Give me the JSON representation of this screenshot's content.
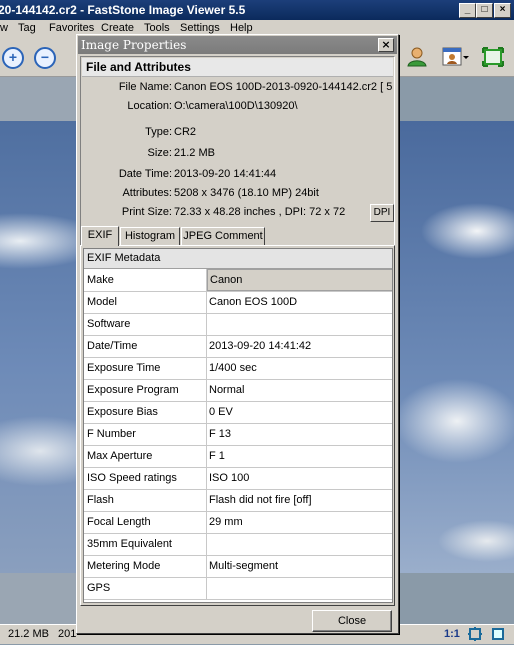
{
  "app": {
    "title": "20-144142.cr2  -  FastStone Image Viewer 5.5",
    "window_buttons": {
      "minimize": "_",
      "maximize": "□",
      "close": "×"
    },
    "menu": [
      "w",
      "Tag",
      "Favorites",
      "Create",
      "Tools",
      "Settings",
      "Help"
    ],
    "status": {
      "size": "21.2 MB",
      "partial": "201",
      "zoom": "1:1"
    }
  },
  "dialog": {
    "title": "Image Properties",
    "close_glyph": "×",
    "file_attributes": {
      "header": "File and Attributes",
      "rows": [
        {
          "label": "File Name:",
          "value": "Canon EOS 100D-2013-0920-144142.cr2   [ 5"
        },
        {
          "label": "Location:",
          "value": "O:\\camera\\100D\\130920\\"
        },
        {
          "label": "Type:",
          "value": "CR2"
        },
        {
          "label": "Size:",
          "value": "21.2 MB"
        },
        {
          "label": "Date Time:",
          "value": "2013-09-20 14:41:44"
        },
        {
          "label": "Attributes:",
          "value": "5208 x 3476 (18.10 MP)  24bit"
        },
        {
          "label": "Print Size:",
          "value": "72.33 x 48.28 inches ,   DPI: 72 x 72"
        }
      ],
      "dpi_button": "DPI"
    },
    "tabs": [
      "EXIF",
      "Histogram",
      "JPEG Comment"
    ],
    "exif": {
      "title": "EXIF Metadata",
      "rows": [
        {
          "key": "Make",
          "value": "Canon"
        },
        {
          "key": "Model",
          "value": "Canon EOS 100D"
        },
        {
          "key": "Software",
          "value": ""
        },
        {
          "key": "Date/Time",
          "value": "2013-09-20 14:41:42"
        },
        {
          "key": "Exposure Time",
          "value": "1/400 sec"
        },
        {
          "key": "Exposure Program",
          "value": "Normal"
        },
        {
          "key": "Exposure Bias",
          "value": "0 EV"
        },
        {
          "key": "F Number",
          "value": "F 13"
        },
        {
          "key": "Max Aperture",
          "value": "F 1"
        },
        {
          "key": "ISO Speed ratings",
          "value": "ISO 100"
        },
        {
          "key": "Flash",
          "value": "Flash did not fire [off]"
        },
        {
          "key": "Focal Length",
          "value": "29 mm"
        },
        {
          "key": "35mm Equivalent",
          "value": ""
        },
        {
          "key": "Metering Mode",
          "value": "Multi-segment"
        },
        {
          "key": "GPS",
          "value": ""
        }
      ]
    },
    "close_button": "Close"
  }
}
